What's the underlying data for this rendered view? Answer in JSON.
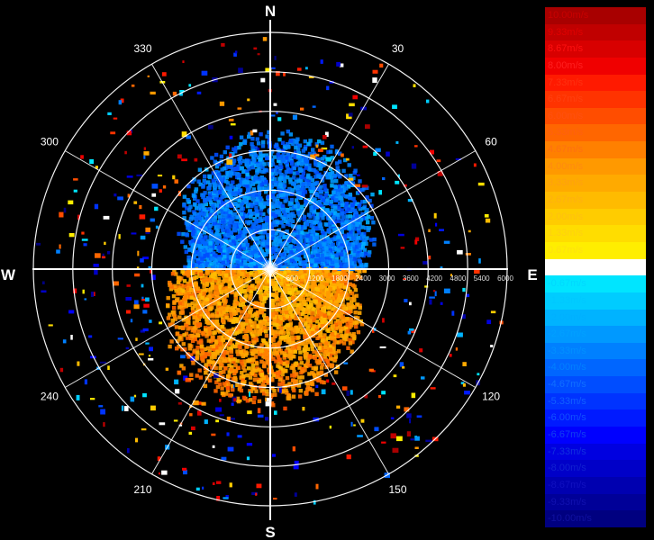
{
  "chart_data": {
    "type": "polar-radar-velocity",
    "compass": {
      "north": "N",
      "east": "E",
      "south": "S",
      "west": "W"
    },
    "azimuth_labels": [
      {
        "angle": 30,
        "text": "30"
      },
      {
        "angle": 60,
        "text": "60"
      },
      {
        "angle": 120,
        "text": "120"
      },
      {
        "angle": 150,
        "text": "150"
      },
      {
        "angle": 210,
        "text": "210"
      },
      {
        "angle": 240,
        "text": "240"
      },
      {
        "angle": 300,
        "text": "300"
      },
      {
        "angle": 330,
        "text": "330"
      }
    ],
    "range_labels": [
      "600",
      "1200",
      "1800",
      "2400",
      "3000",
      "3600",
      "4200",
      "4800",
      "5400",
      "6000"
    ],
    "velocity_scale": [
      {
        "label": "10.00m/s",
        "value": 10.0,
        "color": "#a80000",
        "text_color": "#c80000"
      },
      {
        "label": "9.33m/s",
        "value": 9.33,
        "color": "#c00000",
        "text_color": "#e00000"
      },
      {
        "label": "8.67m/s",
        "value": 8.67,
        "color": "#d80000",
        "text_color": "#ff1010"
      },
      {
        "label": "8.00m/s",
        "value": 8.0,
        "color": "#f00000",
        "text_color": "#ff2020"
      },
      {
        "label": "7.33m/s",
        "value": 7.33,
        "color": "#ff1a00",
        "text_color": "#ff3010"
      },
      {
        "label": "6.67m/s",
        "value": 6.67,
        "color": "#ff3300",
        "text_color": "#ff4010"
      },
      {
        "label": "6.00m/s",
        "value": 6.0,
        "color": "#ff4d00",
        "text_color": "#ff5010"
      },
      {
        "label": "5.33m/s",
        "value": 5.33,
        "color": "#ff6600",
        "text_color": "#ff6010"
      },
      {
        "label": "4.67m/s",
        "value": 4.67,
        "color": "#ff8000",
        "text_color": "#ff7010"
      },
      {
        "label": "4.00m/s",
        "value": 4.0,
        "color": "#ff9900",
        "text_color": "#ff8a10"
      },
      {
        "label": "3.33m/s",
        "value": 3.33,
        "color": "#ffaa00",
        "text_color": "#ffa010"
      },
      {
        "label": "2.67m/s",
        "value": 2.67,
        "color": "#ffbb00",
        "text_color": "#ffb010"
      },
      {
        "label": "2.00m/s",
        "value": 2.0,
        "color": "#ffcc00",
        "text_color": "#ffc010"
      },
      {
        "label": "1.33m/s",
        "value": 1.33,
        "color": "#ffdd00",
        "text_color": "#ffd010"
      },
      {
        "label": "0.67m/s",
        "value": 0.67,
        "color": "#ffee00",
        "text_color": "#ffe010"
      },
      {
        "label": "0.00m/s",
        "value": 0.0,
        "color": "#ffffff",
        "text_color": "#ffffff"
      },
      {
        "label": "-0.67m/s",
        "value": -0.67,
        "color": "#00e5ff",
        "text_color": "#00d8ff"
      },
      {
        "label": "-1.33m/s",
        "value": -1.33,
        "color": "#00ccff",
        "text_color": "#00c8ff"
      },
      {
        "label": "-2.00m/s",
        "value": -2.0,
        "color": "#00b3ff",
        "text_color": "#00b0ff"
      },
      {
        "label": "-2.67m/s",
        "value": -2.67,
        "color": "#0099ff",
        "text_color": "#00a0ff"
      },
      {
        "label": "-3.33m/s",
        "value": -3.33,
        "color": "#0080ff",
        "text_color": "#0090ff"
      },
      {
        "label": "-4.00m/s",
        "value": -4.0,
        "color": "#0066ff",
        "text_color": "#0080ff"
      },
      {
        "label": "-4.67m/s",
        "value": -4.67,
        "color": "#004dff",
        "text_color": "#1070ff"
      },
      {
        "label": "-5.33m/s",
        "value": -5.33,
        "color": "#0033ff",
        "text_color": "#1060ff"
      },
      {
        "label": "-6.00m/s",
        "value": -6.0,
        "color": "#001aff",
        "text_color": "#1050ff"
      },
      {
        "label": "-6.67m/s",
        "value": -6.67,
        "color": "#0000ff",
        "text_color": "#1040f0"
      },
      {
        "label": "-7.33m/s",
        "value": -7.33,
        "color": "#0000e0",
        "text_color": "#1030e0"
      },
      {
        "label": "-8.00m/s",
        "value": -8.0,
        "color": "#0000c8",
        "text_color": "#1020d0"
      },
      {
        "label": "-8.67m/s",
        "value": -8.67,
        "color": "#0000b0",
        "text_color": "#1010c0"
      },
      {
        "label": "-9.33m/s",
        "value": -9.33,
        "color": "#000098",
        "text_color": "#1010b0"
      },
      {
        "label": "-10.00m/s",
        "value": -10.0,
        "color": "#000080",
        "text_color": "#1010a0"
      }
    ],
    "echo_pattern": {
      "north_half_velocity_ms": -3.5,
      "south_half_velocity_ms": 3.0,
      "dense_echo_max_range_fraction": 0.55,
      "grid": true
    }
  }
}
